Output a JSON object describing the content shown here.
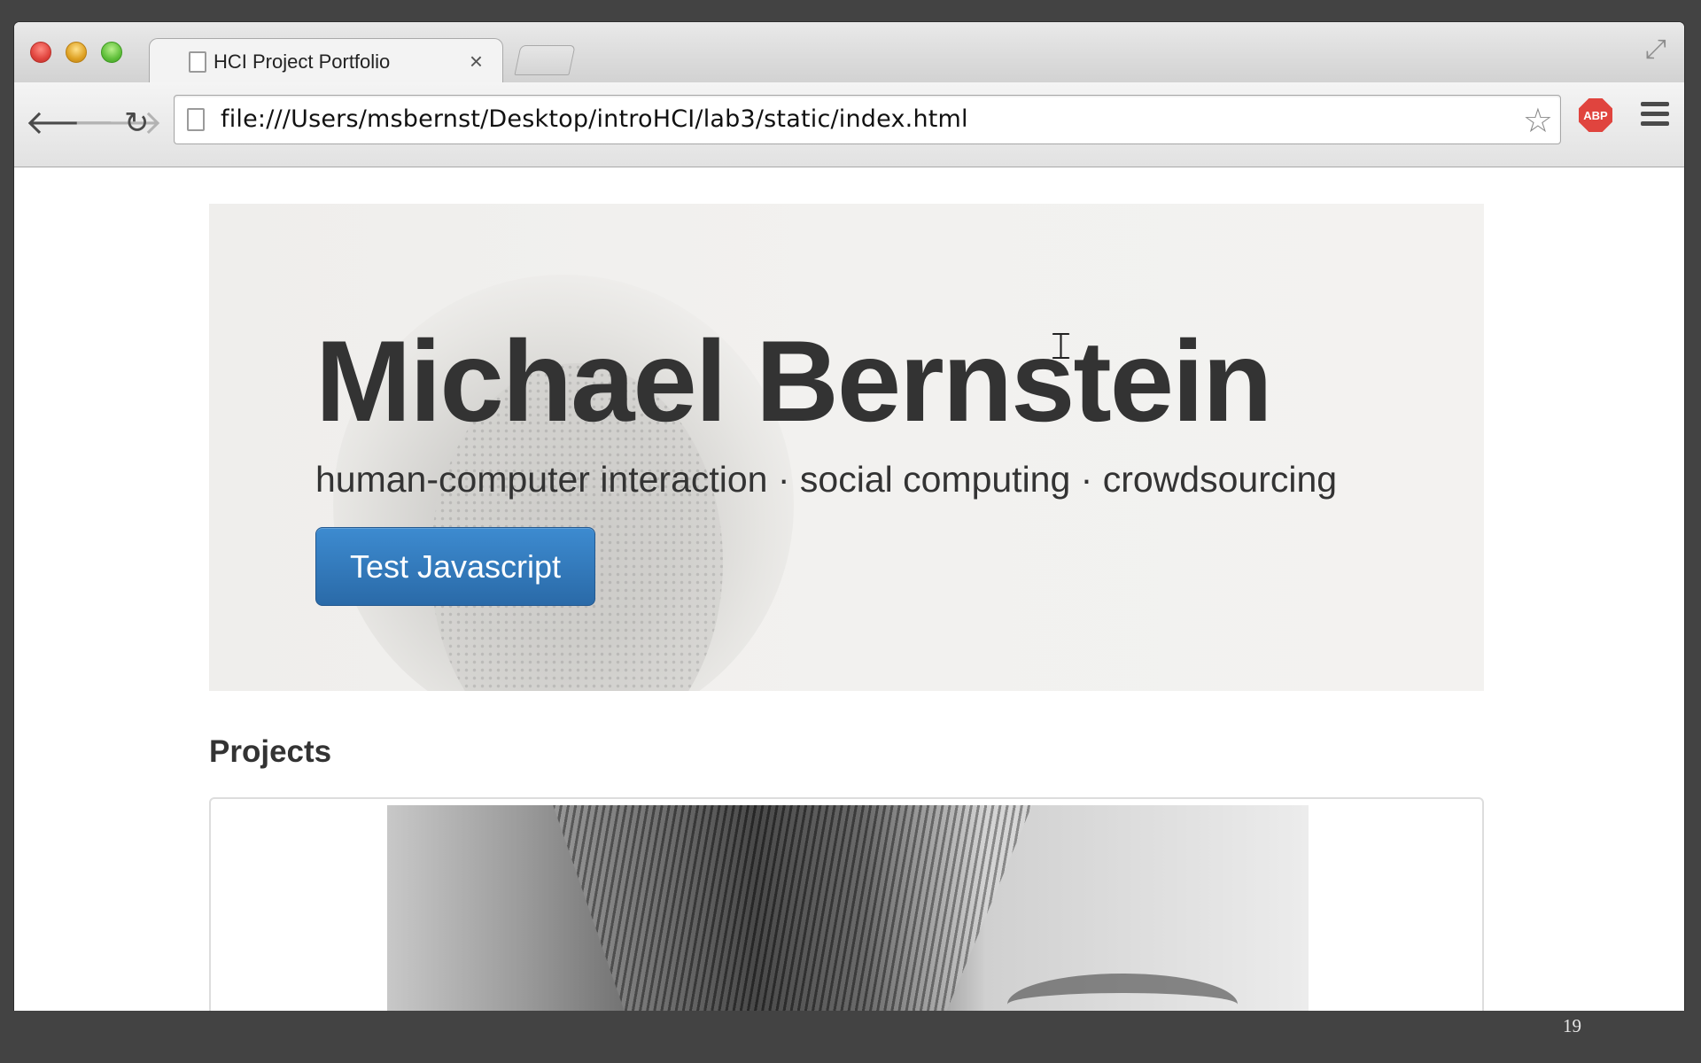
{
  "browser": {
    "tab": {
      "title": "HCI Project Portfolio",
      "close_glyph": "×"
    },
    "url": "file:///Users/msbernst/Desktop/introHCI/lab3/static/index.html",
    "abp_label": "ABP"
  },
  "hero": {
    "name": "Michael Bernstein",
    "tagline": "human-computer interaction · social computing · crowdsourcing",
    "button_label": "Test Javascript"
  },
  "projects": {
    "heading": "Projects"
  },
  "slide": {
    "number": "19"
  },
  "icons": {
    "back": "back-arrow-icon",
    "forward": "forward-arrow-icon",
    "reload": "reload-icon",
    "star": "bookmark-star-icon",
    "menu": "hamburger-menu-icon",
    "fullscreen": "fullscreen-icon"
  }
}
